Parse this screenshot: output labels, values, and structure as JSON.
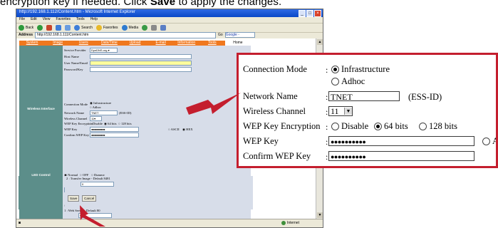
{
  "instruction": {
    "text_before": "encryption key if needed. Click ",
    "save_word": "Save",
    "text_after": " to apply the changes."
  },
  "browser": {
    "title": "http://192.168.1.112/Content.htm - Microsoft Internet Explorer",
    "menu": [
      "File",
      "Edit",
      "View",
      "Favorites",
      "Tools",
      "Help"
    ],
    "toolbar": [
      "Back",
      "Search",
      "Favorites",
      "Media"
    ],
    "address_label": "Address",
    "address_value": "http://192.168.1.111/Content.htm",
    "go_label": "Go",
    "google_label": "Google -",
    "status_zone": "Internet"
  },
  "nav": {
    "tabs": [
      "System",
      "Image",
      "Users",
      "Date/Time",
      "Upload",
      "E-mail",
      "Information",
      "Tools",
      "Home"
    ],
    "active": "Home"
  },
  "form": {
    "service_provider_label": "Service Provider",
    "service_provider_value": "DynDNS.org",
    "host_name_label": "Host Name",
    "user_name_label": "User Name/Email",
    "password_label": "Password/Key",
    "wireless_section": "Wireless Interface",
    "connection_mode_label": "Connection Mode",
    "infrastructure": "Infrastructure",
    "adhoc": "Adhoc",
    "network_name_label": "Network Name",
    "network_name_value": "TNET",
    "ess_id": "(ESS-ID)",
    "wireless_channel_label": "Wireless Channel",
    "wireless_channel_value": "11",
    "wep_enc_label": "WEP Key Encryption",
    "disable": "Disable",
    "bits64": "64 bits",
    "bits128": "128 bits",
    "wep_key_label": "WEP Key",
    "wep_key_value": "●●●●●●●●●●",
    "ascii": "ASCII",
    "hex": "HEX",
    "confirm_wep_label": "Confirm WEP Key",
    "confirm_wep_value": "●●●●●●●●●●",
    "led_section": "LED Control",
    "led_normal": "Normal",
    "led_off": "OFF",
    "led_dummy": "Dummy",
    "loading_section": "Loading ActiveX From",
    "open_port_section": "Open Second Port",
    "yes": "Yes",
    "no": "No",
    "web_server": "1 : Web Server    - Default 80",
    "web_server_value": "0",
    "transfer_image": "2 : Transfer Image - Default 8481",
    "transfer_value": "0",
    "save_button": "Save",
    "cancel_button": "Cancel"
  },
  "zoom": {
    "connection_mode_label": "Connection Mode",
    "infrastructure": "Infrastructure",
    "adhoc": "Adhoc",
    "network_name_label": "Network Name",
    "network_name_value": "TNET",
    "ess_id": "(ESS-ID)",
    "wireless_channel_label": "Wireless Channel",
    "wireless_channel_value": "11",
    "wep_enc_label": "WEP Key Encryption",
    "disable": "Disable",
    "bits64": "64 bits",
    "bits128": "128 bits",
    "wep_key_label": "WEP Key",
    "wep_key_value": "●●●●●●●●●●",
    "ascii_partial": "A",
    "confirm_wep_label": "Confirm WEP Key",
    "confirm_wep_value": "●●●●●●●●●●",
    "colon": ":"
  },
  "colors": {
    "accent_arrow": "#c41e2e",
    "nav_orange": "#f0781e",
    "side_teal": "#5c8e8a",
    "form_bg": "#d7dde9"
  }
}
